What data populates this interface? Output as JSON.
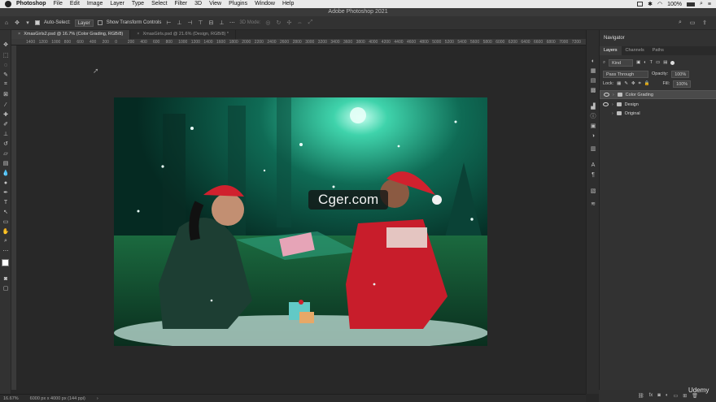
{
  "menubar": {
    "app": "Photoshop",
    "items": [
      "File",
      "Edit",
      "Image",
      "Layer",
      "Type",
      "Select",
      "Filter",
      "3D",
      "View",
      "Plugins",
      "Window",
      "Help"
    ],
    "battery": "100%"
  },
  "window": {
    "title": "Adobe Photoshop 2021"
  },
  "options": {
    "auto_select_label": "Auto-Select:",
    "auto_select_value": "Layer",
    "transform_label": "Show Transform Controls",
    "mode_3d": "3D Mode:"
  },
  "tabs": [
    {
      "label": "XmasGirls2.psd @ 16.7% (Color Grading, RGB/8)"
    },
    {
      "label": "XmasGirls.psd @ 21.6% (Design, RGB/8) *"
    }
  ],
  "ruler": [
    "1400",
    "1200",
    "1000",
    "800",
    "600",
    "400",
    "200",
    "0",
    "200",
    "400",
    "600",
    "800",
    "1000",
    "1200",
    "1400",
    "1600",
    "1800",
    "2000",
    "2200",
    "2400",
    "2600",
    "2800",
    "3000",
    "3200",
    "3400",
    "3600",
    "3800",
    "4000",
    "4200",
    "4400",
    "4600",
    "4800",
    "5000",
    "5200",
    "5400",
    "5600",
    "5800",
    "6000",
    "6200",
    "6400",
    "6600",
    "6800",
    "7000",
    "7200"
  ],
  "panels": {
    "navigator": "Navigator",
    "tabs": [
      "Layers",
      "Channels",
      "Paths"
    ],
    "filter": "Kind",
    "blend": "Pass Through",
    "opacity_label": "Opacity:",
    "opacity": "100%",
    "lock_label": "Lock:",
    "fill_label": "Fill:",
    "fill": "100%",
    "layers": [
      {
        "name": "Color Grading",
        "visible": true,
        "selected": true
      },
      {
        "name": "Design",
        "visible": true,
        "selected": false
      },
      {
        "name": "Original",
        "visible": false,
        "selected": false
      }
    ]
  },
  "status": {
    "zoom": "16.67%",
    "doc": "6000 px x 4000 px (144 ppi)"
  },
  "watermark": "Cger.com",
  "brand": "Udemy",
  "colors": {
    "accent": "#2fbf9a",
    "menubar": "#e9e9e9",
    "panel": "#323232",
    "canvas_bg": "#282828"
  }
}
